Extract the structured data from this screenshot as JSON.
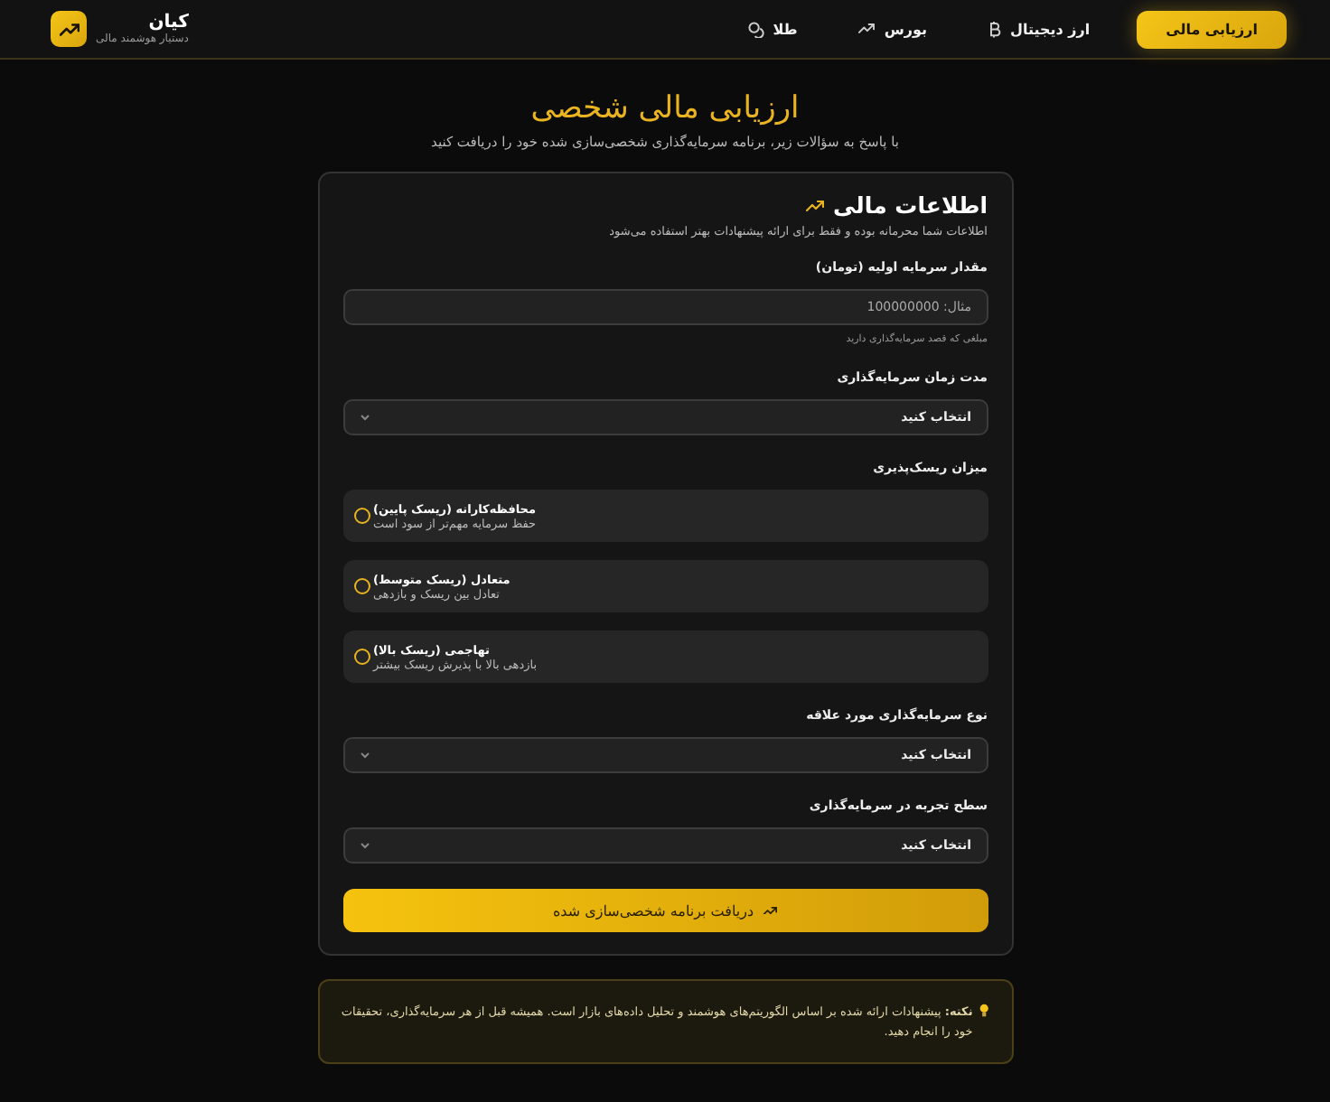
{
  "header": {
    "brand": "کیان",
    "tagline": "دستیار هوشمند مالی",
    "nav": [
      {
        "label": "ارزیابی مالی",
        "selected": true,
        "kind": "plain"
      },
      {
        "label": "ارز دیجیتال",
        "selected": false,
        "kind": "crypto"
      },
      {
        "label": "بورس",
        "selected": false,
        "kind": "stocks"
      },
      {
        "label": "طلا",
        "selected": false,
        "kind": "gold"
      }
    ]
  },
  "page": {
    "title": "ارزیابی مالی شخصی",
    "subtitle": "با پاسخ به سؤالات زیر، برنامه سرمایه‌گذاری شخصی‌سازی شده خود را دریافت کنید"
  },
  "form": {
    "title": "اطلاعات مالی",
    "description": "اطلاعات شما محرمانه بوده و فقط برای ارائه پیشنهادات بهتر استفاده می‌شود",
    "fields": [
      {
        "kind": "input",
        "label": "مقدار سرمایه اولیه (تومان)",
        "placeholder": "مثال: 100000000",
        "hint": "مبلغی که قصد سرمایه‌گذاری دارید"
      },
      {
        "kind": "select",
        "label": "مدت زمان سرمایه‌گذاری",
        "value": "انتخاب کنید"
      },
      {
        "kind": "radio",
        "label": "میزان ریسک‌پذیری",
        "options": [
          {
            "title": "محافظه‌کارانه (ریسک پایین)",
            "description": "حفظ سرمایه مهم‌تر از سود است",
            "selected": false
          },
          {
            "title": "متعادل (ریسک متوسط)",
            "description": "تعادل بین ریسک و بازدهی",
            "selected": false
          },
          {
            "title": "تهاجمی (ریسک بالا)",
            "description": "بازدهی بالا با پذیرش ریسک بیشتر",
            "selected": false
          }
        ]
      },
      {
        "kind": "select",
        "label": "نوع سرمایه‌گذاری مورد علاقه",
        "value": "انتخاب کنید"
      },
      {
        "kind": "select",
        "label": "سطح تجربه در سرمایه‌گذاری",
        "value": "انتخاب کنید"
      }
    ],
    "submit": "دریافت برنامه شخصی‌سازی شده"
  },
  "note": "**نکته:** پیشنهادات ارائه شده بر اساس الگوریتم‌های هوشمند و تحلیل داده‌های بازار است. همیشه قبل از هر سرمایه‌گذاری، تحقیقات خود را انجام دهید."
}
